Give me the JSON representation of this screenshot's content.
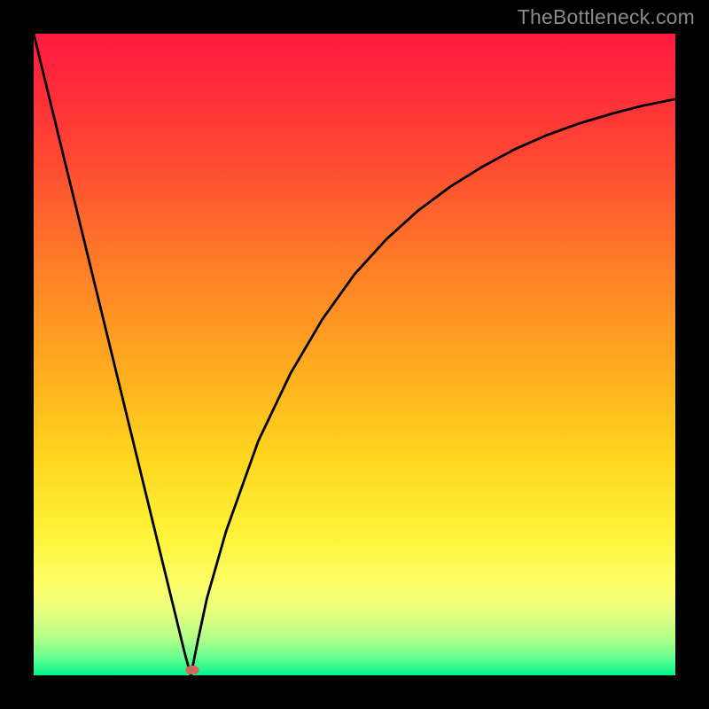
{
  "watermark": "TheBottleneck.com",
  "marker": {
    "x_frac": 0.247,
    "y_frac": 0.992,
    "color": "#d0685f"
  },
  "chart_data": {
    "type": "line",
    "title": "",
    "xlabel": "",
    "ylabel": "",
    "xlim": [
      0,
      1
    ],
    "ylim": [
      0,
      1
    ],
    "grid": false,
    "legend": false,
    "background": "heatmap-gradient (red-top to green-bottom)",
    "series": [
      {
        "name": "left-branch",
        "x": [
          0.0,
          0.05,
          0.1,
          0.15,
          0.2,
          0.22,
          0.235,
          0.245
        ],
        "y": [
          1.0,
          0.795,
          0.59,
          0.385,
          0.18,
          0.098,
          0.036,
          0.0
        ]
      },
      {
        "name": "right-branch",
        "x": [
          0.245,
          0.255,
          0.27,
          0.3,
          0.35,
          0.4,
          0.45,
          0.5,
          0.55,
          0.6,
          0.65,
          0.7,
          0.75,
          0.8,
          0.85,
          0.9,
          0.95,
          1.0
        ],
        "y": [
          0.0,
          0.05,
          0.12,
          0.225,
          0.365,
          0.47,
          0.555,
          0.625,
          0.68,
          0.725,
          0.762,
          0.793,
          0.82,
          0.842,
          0.86,
          0.875,
          0.888,
          0.898
        ]
      }
    ],
    "annotations": [
      {
        "type": "marker",
        "name": "optimal-point",
        "x": 0.247,
        "y": 0.008
      }
    ]
  }
}
